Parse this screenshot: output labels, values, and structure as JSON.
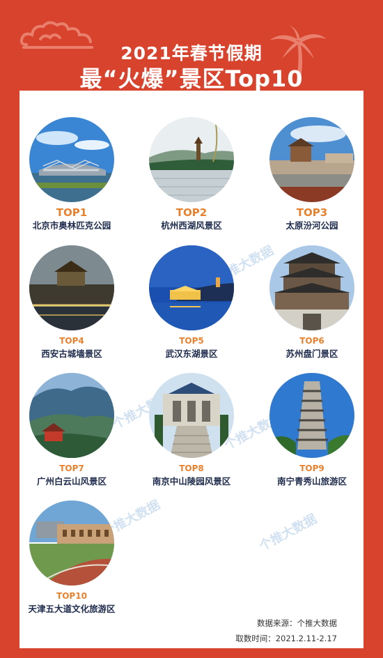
{
  "header": {
    "title_line1": "2021年春节假期",
    "title_line2": "最“火爆”景区Top10"
  },
  "items": [
    {
      "rank": "TOP1",
      "name": "北京市奥林匹克公园"
    },
    {
      "rank": "TOP2",
      "name": "杭州西湖风景区"
    },
    {
      "rank": "TOP3",
      "name": "太原汾河公园"
    },
    {
      "rank": "TOP4",
      "name": "西安古城墙景区"
    },
    {
      "rank": "TOP5",
      "name": "武汉东湖景区"
    },
    {
      "rank": "TOP6",
      "name": "苏州盘门景区"
    },
    {
      "rank": "TOP7",
      "name": "广州白云山风景区"
    },
    {
      "rank": "TOP8",
      "name": "南京中山陵园风景区"
    },
    {
      "rank": "TOP9",
      "name": "南宁青秀山旅游区"
    },
    {
      "rank": "TOP10",
      "name": "天津五大道文化旅游区"
    }
  ],
  "watermark": "个推大数据",
  "footer": {
    "source": "数据来源：个推大数据",
    "period": "取数时间：2021.2.11-2.17"
  }
}
